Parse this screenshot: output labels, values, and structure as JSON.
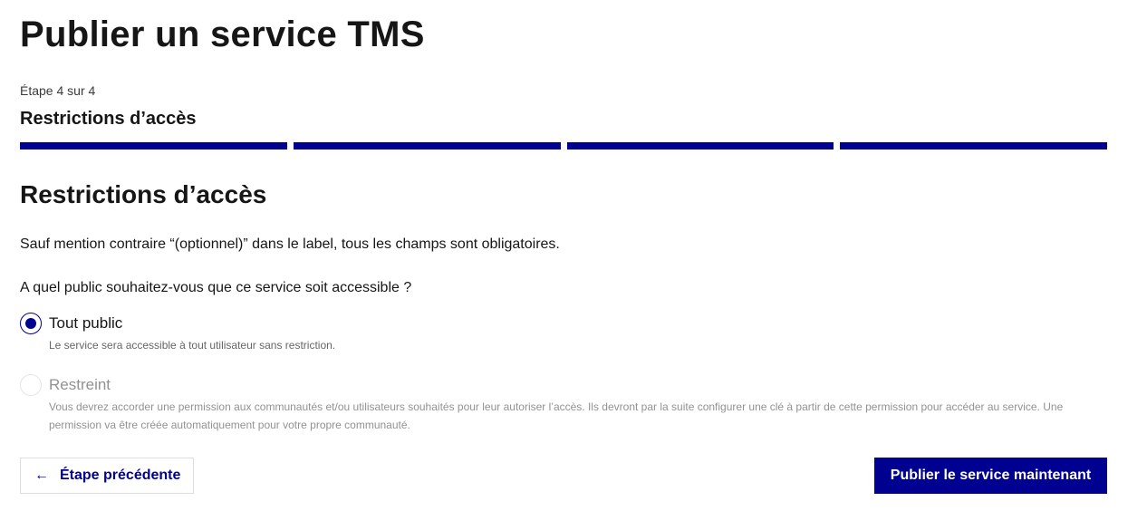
{
  "page": {
    "title": "Publier un service TMS"
  },
  "stepper": {
    "count_label": "Étape 4 sur 4",
    "current_title": "Restrictions d’accès",
    "total_steps": 4,
    "completed_steps": 4,
    "active_color": "#000091"
  },
  "section": {
    "title": "Restrictions d’accès",
    "hint": "Sauf mention contraire “(optionnel)” dans le label, tous les champs sont obligatoires."
  },
  "access_question": {
    "legend": "A quel public souhaitez-vous que ce service soit accessible ?",
    "options": [
      {
        "label": "Tout public",
        "description": "Le service sera accessible à tout utilisateur sans restriction.",
        "checked": true,
        "disabled": false
      },
      {
        "label": "Restreint",
        "description": "Vous devrez accorder une permission aux communautés et/ou utilisateurs souhaités pour leur autoriser l’accès. Ils devront par la suite configurer une clé à partir de cette permission pour accéder au service. Une permission va être créée automatiquement pour votre propre communauté.",
        "checked": false,
        "disabled": true
      }
    ]
  },
  "actions": {
    "previous_label": "Étape précédente",
    "previous_icon": "arrow-left-icon",
    "publish_label": "Publier le service maintenant"
  },
  "colors": {
    "primary": "#000091",
    "text": "#161616",
    "muted": "#666666",
    "disabled": "#929292"
  }
}
